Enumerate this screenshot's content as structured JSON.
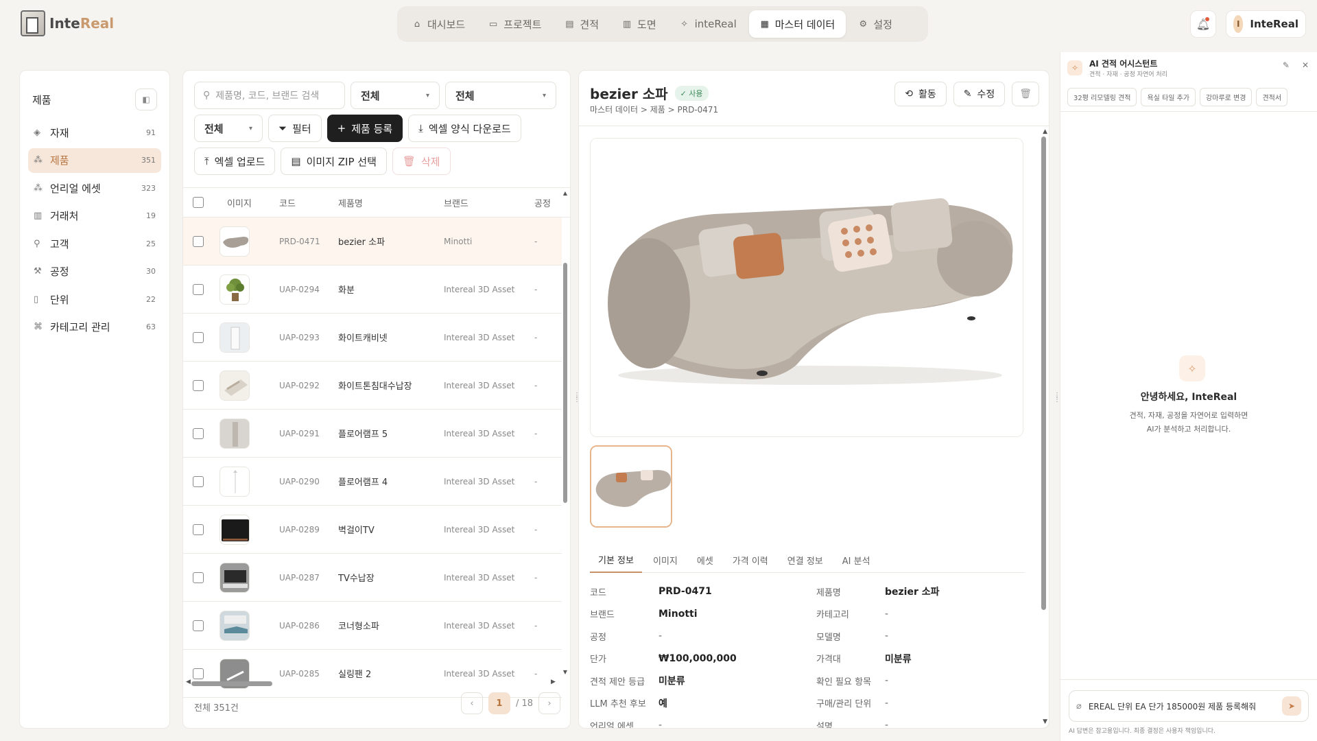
{
  "app": {
    "logo_main": "Inte",
    "logo_accent": "Real"
  },
  "nav": [
    {
      "label": "대시보드",
      "icon": "home-icon"
    },
    {
      "label": "프로젝트",
      "icon": "folder-icon"
    },
    {
      "label": "견적",
      "icon": "document-icon"
    },
    {
      "label": "도면",
      "icon": "map-icon"
    },
    {
      "label": "inteReal",
      "icon": "sparkle-icon"
    },
    {
      "label": "마스터 데이터",
      "icon": "grid-icon",
      "active": true
    },
    {
      "label": "설정",
      "icon": "gear-icon"
    }
  ],
  "user": {
    "initial": "I",
    "name": "InteReal"
  },
  "sidebar": {
    "title": "제품",
    "items": [
      {
        "label": "자재",
        "count": "91"
      },
      {
        "label": "제품",
        "count": "351",
        "active": true
      },
      {
        "label": "언리얼 에셋",
        "count": "323"
      },
      {
        "label": "거래처",
        "count": "19"
      },
      {
        "label": "고객",
        "count": "25"
      },
      {
        "label": "공정",
        "count": "30"
      },
      {
        "label": "단위",
        "count": "22"
      },
      {
        "label": "카테고리 관리",
        "count": "63"
      }
    ]
  },
  "list": {
    "search_placeholder": "제품명, 코드, 브랜드 검색",
    "select1": "전체",
    "select2": "전체",
    "select3": "전체",
    "filter_label": "필터",
    "register_label": "제품 등록",
    "download_label": "엑셀 양식 다운로드",
    "upload_label": "엑셀 업로드",
    "zip_label": "이미지 ZIP 선택",
    "delete_label": "삭제",
    "columns": [
      "이미지",
      "코드",
      "제품명",
      "브랜드",
      "공정"
    ],
    "rows": [
      {
        "code": "PRD-0471",
        "name": "bezier 소파",
        "brand": "Minotti",
        "process": "-",
        "thumb": "sofa"
      },
      {
        "code": "UAP-0294",
        "name": "화분",
        "brand": "Intereal 3D Asset",
        "process": "-",
        "thumb": "plant"
      },
      {
        "code": "UAP-0293",
        "name": "화이트캐비넷",
        "brand": "Intereal 3D Asset",
        "process": "-",
        "thumb": "cabinet"
      },
      {
        "code": "UAP-0292",
        "name": "화이트톤침대수납장",
        "brand": "Intereal 3D Asset",
        "process": "-",
        "thumb": "bed"
      },
      {
        "code": "UAP-0291",
        "name": "플로어램프 5",
        "brand": "Intereal 3D Asset",
        "process": "-",
        "thumb": "lamp5"
      },
      {
        "code": "UAP-0290",
        "name": "플로어램프 4",
        "brand": "Intereal 3D Asset",
        "process": "-",
        "thumb": "lamp4"
      },
      {
        "code": "UAP-0289",
        "name": "벽걸이TV",
        "brand": "Intereal 3D Asset",
        "process": "-",
        "thumb": "tv"
      },
      {
        "code": "UAP-0287",
        "name": "TV수납장",
        "brand": "Intereal 3D Asset",
        "process": "-",
        "thumb": "tvstand"
      },
      {
        "code": "UAP-0286",
        "name": "코너형소파",
        "brand": "Intereal 3D Asset",
        "process": "-",
        "thumb": "corner"
      },
      {
        "code": "UAP-0285",
        "name": "실링팬 2",
        "brand": "Intereal 3D Asset",
        "process": "-",
        "thumb": "fan"
      }
    ],
    "total": "전체 351건",
    "page": "1",
    "page_total": "/ 18"
  },
  "detail": {
    "name": "bezier 소파",
    "status": "✓ 사용",
    "breadcrumb": "마스터 데이터 > 제품 > PRD-0471",
    "activity_label": "활동",
    "edit_label": "수정",
    "tabs": [
      "기본 정보",
      "이미지",
      "에셋",
      "가격 이력",
      "연결 정보",
      "AI 분석"
    ],
    "fields_left": [
      {
        "k": "코드",
        "v": "PRD-0471"
      },
      {
        "k": "브랜드",
        "v": "Minotti"
      },
      {
        "k": "공정",
        "v": "-"
      },
      {
        "k": "단가",
        "v": "₩100,000,000"
      },
      {
        "k": "견적 제안 등급",
        "v": "미분류"
      },
      {
        "k": "LLM 추천 후보",
        "v": "예"
      },
      {
        "k": "언리얼 에셋",
        "v": "-"
      }
    ],
    "fields_right": [
      {
        "k": "제품명",
        "v": "bezier 소파"
      },
      {
        "k": "카테고리",
        "v": "-"
      },
      {
        "k": "모델명",
        "v": "-"
      },
      {
        "k": "가격대",
        "v": "미분류"
      },
      {
        "k": "확인 필요 항목",
        "v": "-"
      },
      {
        "k": "구매/관리 단위",
        "v": "-"
      },
      {
        "k": "설명",
        "v": "-"
      }
    ]
  },
  "ai": {
    "title": "AI 견적 어시스턴트",
    "subtitle": "견적 · 자재 · 공정 자연어 처리",
    "chips": [
      "32평 리모델링 견적",
      "욕실 타일 추가",
      "강마루로 변경",
      "견적서"
    ],
    "greeting": "안녕하세요, InteReal",
    "greeting_sub1": "견적, 자재, 공정을 자연어로 입력하면",
    "greeting_sub2": "AI가 분석하고 처리합니다.",
    "input_value": "EREAL 단위 EA 단가 185000원 제품 등록해줘",
    "note": "AI 답변은 참고용입니다. 최종 결정은 사용자 책임입니다."
  },
  "colors": {
    "accent": "#c89066",
    "active_bg": "#f7e7da",
    "dark_button": "#1f1f1f"
  }
}
